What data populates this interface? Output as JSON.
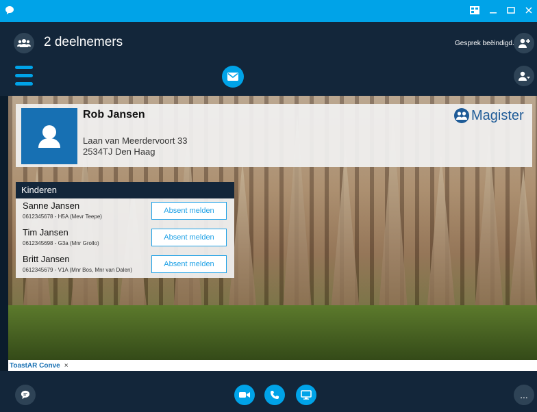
{
  "header": {
    "participants_title": "2 deelnemers",
    "call_status": "Gesprek beëindigd."
  },
  "contact": {
    "name": "Rob Jansen",
    "address_line1": "Laan van Meerdervoort 33",
    "address_line2": "2534TJ Den Haag",
    "brand": "Magister"
  },
  "kids": {
    "title": "Kinderen",
    "items": [
      {
        "name": "Sanne Jansen",
        "detail": "0612345678 - H5A (Mevr Teepe)",
        "button": "Absent melden"
      },
      {
        "name": "Tim Jansen",
        "detail": "0612345698 - G3a (Mnr Grollo)",
        "button": "Absent melden"
      },
      {
        "name": "Britt Jansen",
        "detail": "0612345679 - V1A (Mnr Bos, Mnr van Dalen)",
        "button": "Absent melden"
      }
    ]
  },
  "tabs": {
    "conversation_tab": "ToastAR Conve",
    "close": "×"
  },
  "bottom": {
    "more": "..."
  },
  "colors": {
    "accent": "#00a3e8",
    "dark_bg": "#13263a",
    "avatar_bg": "#1770b3",
    "brand": "#1e5b97"
  }
}
